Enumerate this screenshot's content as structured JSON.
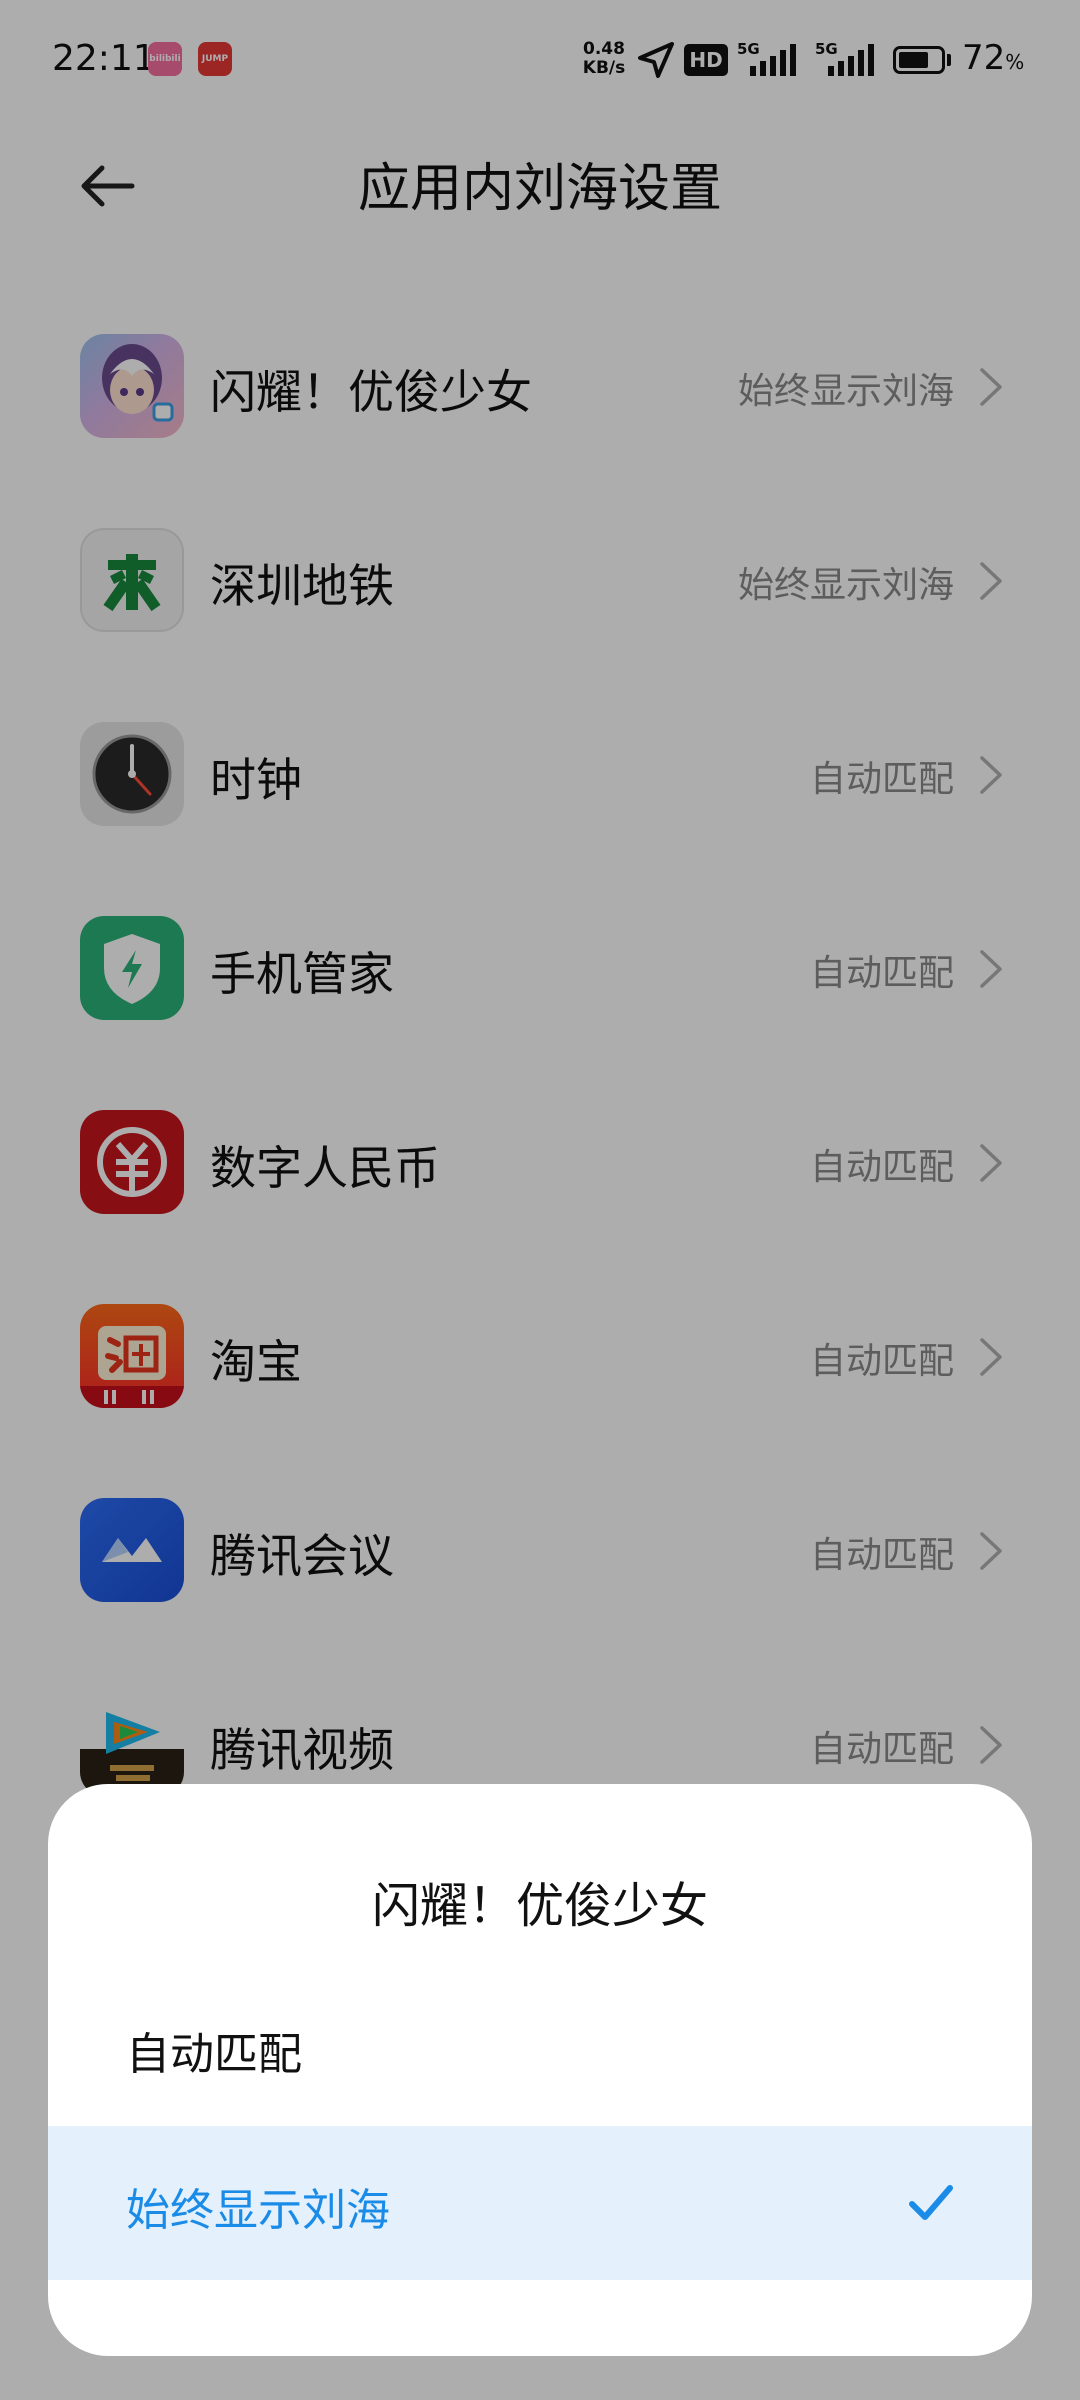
{
  "status_bar": {
    "time": "22:11",
    "app_badges": [
      "bilibili",
      "JUMP"
    ],
    "net_speed_value": "0.48",
    "net_speed_unit": "KB/s",
    "hd_label": "HD",
    "signal_1_label": "5G",
    "signal_2_label": "5G",
    "battery_percent": "72",
    "battery_sign": "%",
    "battery_level": 0.72
  },
  "header": {
    "title": "应用内刘海设置"
  },
  "apps": [
    {
      "name": "闪耀！优俊少女",
      "value": "始终显示刘海",
      "icon": "uma-musume-icon"
    },
    {
      "name": "深圳地铁",
      "value": "始终显示刘海",
      "icon": "shenzhen-metro-icon"
    },
    {
      "name": "时钟",
      "value": "自动匹配",
      "icon": "clock-icon"
    },
    {
      "name": "手机管家",
      "value": "自动匹配",
      "icon": "security-shield-icon"
    },
    {
      "name": "数字人民币",
      "value": "自动匹配",
      "icon": "digital-rmb-icon"
    },
    {
      "name": "淘宝",
      "value": "自动匹配",
      "icon": "taobao-icon"
    },
    {
      "name": "腾讯会议",
      "value": "自动匹配",
      "icon": "tencent-meeting-icon"
    },
    {
      "name": "腾讯视频",
      "value": "自动匹配",
      "icon": "tencent-video-icon"
    }
  ],
  "sheet": {
    "title": "闪耀！优俊少女",
    "options": [
      {
        "label": "自动匹配",
        "selected": false
      },
      {
        "label": "始终显示刘海",
        "selected": true
      }
    ]
  },
  "colors": {
    "accent": "#1a8ce8",
    "selected_bg": "#e4f1fc",
    "secondary_text": "#8a8a8a"
  }
}
